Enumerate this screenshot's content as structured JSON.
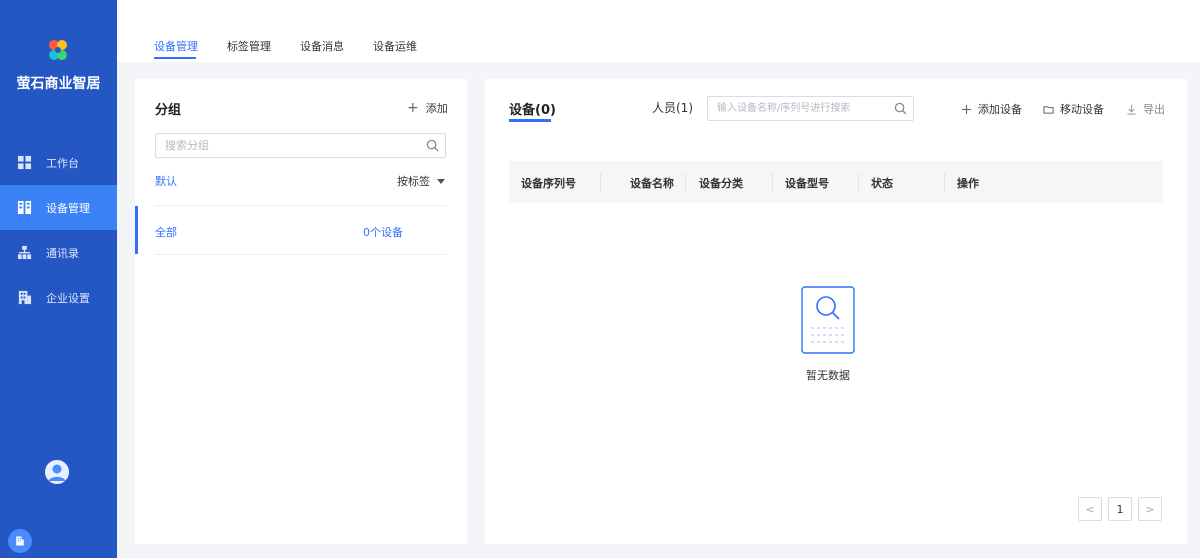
{
  "sidebar": {
    "brand": "萤石商业智居",
    "items": [
      {
        "label": "工作台",
        "icon": "dashboard-icon"
      },
      {
        "label": "设备管理",
        "icon": "device-icon",
        "active": true
      },
      {
        "label": "通讯录",
        "icon": "org-tree-icon"
      },
      {
        "label": "企业设置",
        "icon": "building-icon"
      }
    ],
    "accent": "#2557c4",
    "active_color": "#3b82f6"
  },
  "top_tabs": [
    "设备管理",
    "标签管理",
    "设备消息",
    "设备运维"
  ],
  "group_panel": {
    "title": "分组",
    "add_label": "添加",
    "search_placeholder": "搜索分组",
    "default_label": "默认",
    "sort_label": "按标签",
    "groups": [
      {
        "name": "全部",
        "count": "0个设备"
      }
    ]
  },
  "device_panel": {
    "tab_devices": "设备(0)",
    "tab_people": "人员(1)",
    "search_placeholder": "输入设备名称/序列号进行搜索",
    "actions": {
      "add": "添加设备",
      "move": "移动设备",
      "export": "导出"
    },
    "columns": [
      "设备序列号",
      "设备名称",
      "设备分类",
      "设备型号",
      "状态",
      "操作"
    ],
    "rows": [],
    "empty_text": "暂无数据",
    "pagination": {
      "prev": "<",
      "current": "1",
      "next": ">"
    }
  },
  "colors": {
    "primary": "#3370ff",
    "background": "#f3f5f9"
  }
}
